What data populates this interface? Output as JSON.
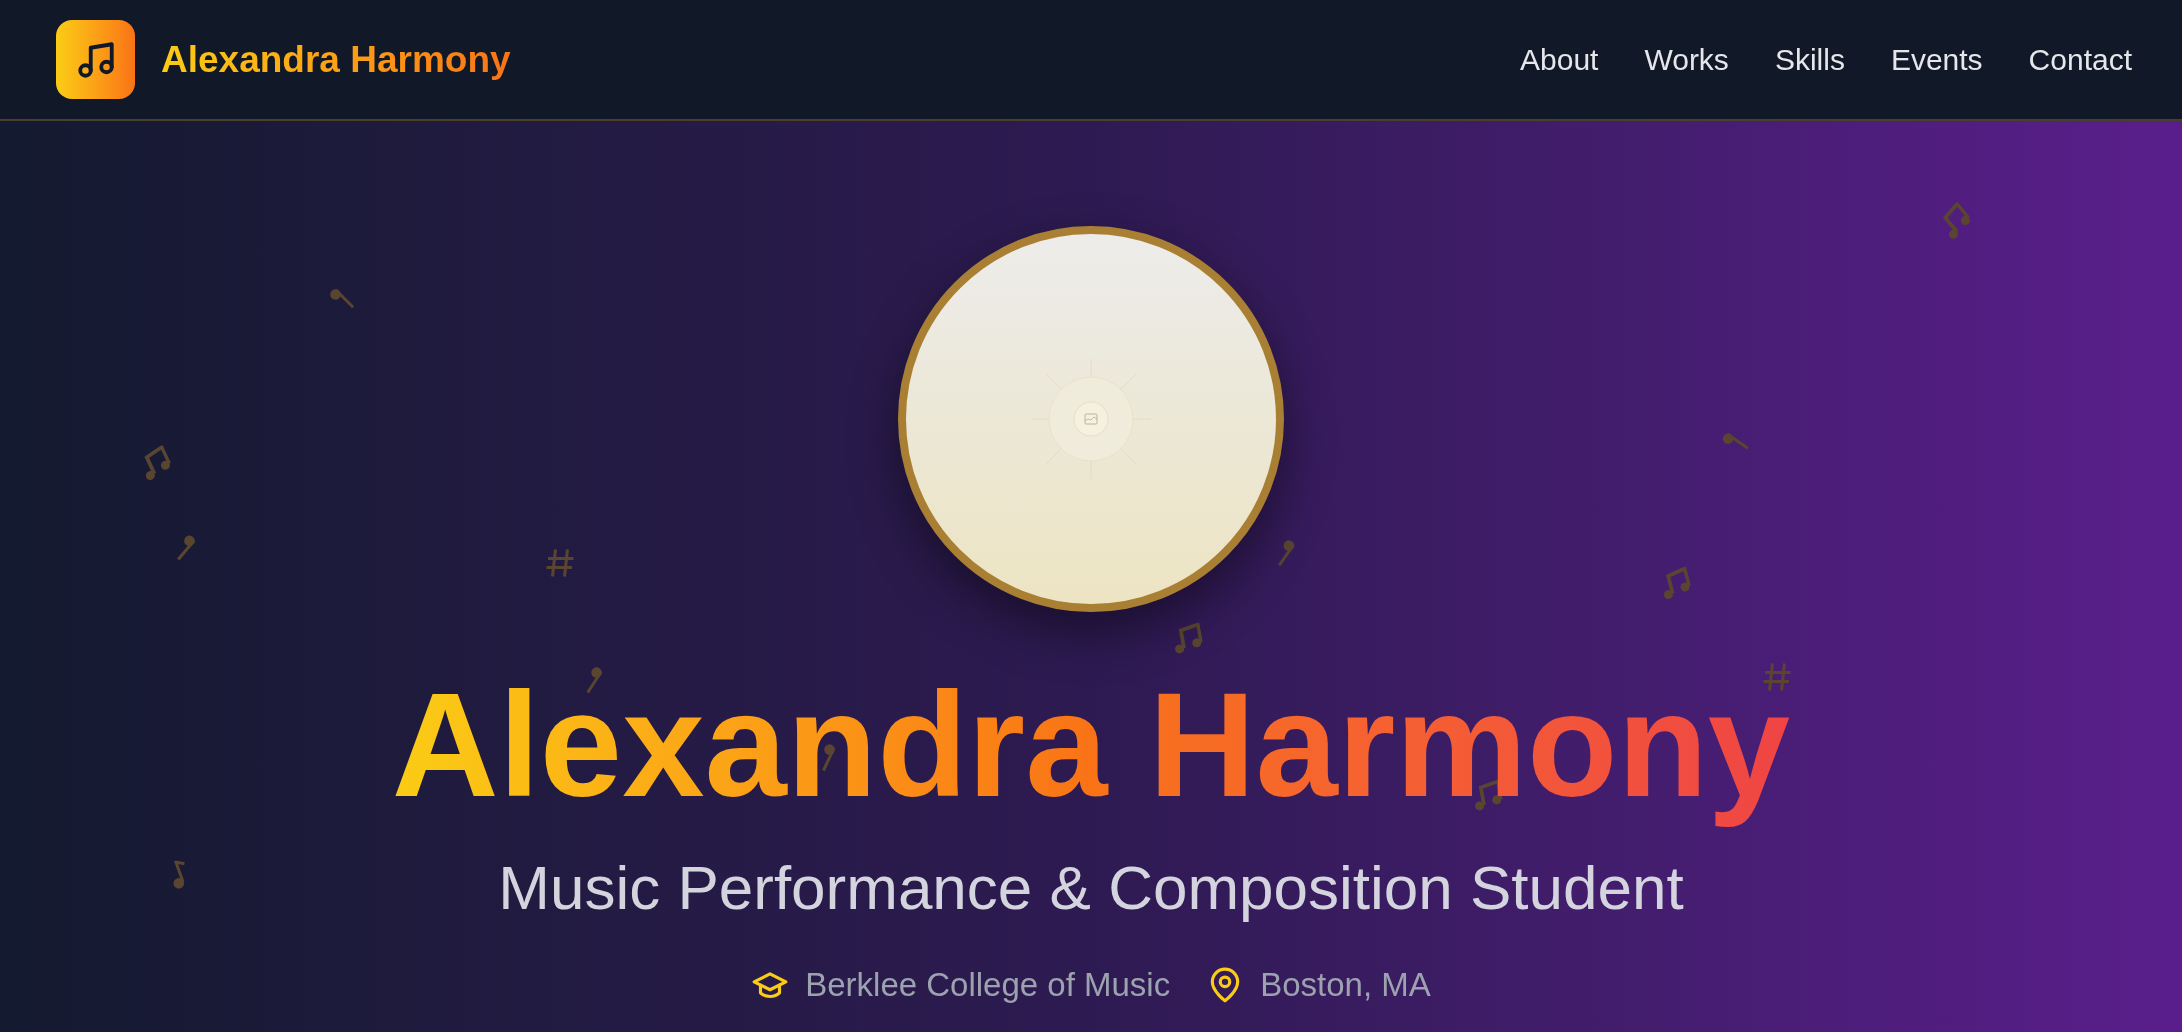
{
  "brand": {
    "name": "Alexandra Harmony"
  },
  "nav": [
    {
      "label": "About"
    },
    {
      "label": "Works"
    },
    {
      "label": "Skills"
    },
    {
      "label": "Events"
    },
    {
      "label": "Contact"
    }
  ],
  "hero": {
    "name": "Alexandra Harmony",
    "subtitle": "Music Performance & Composition Student",
    "details": [
      {
        "kind": "school",
        "text": "Berklee College of Music"
      },
      {
        "kind": "location",
        "text": "Boston, MA"
      }
    ]
  }
}
